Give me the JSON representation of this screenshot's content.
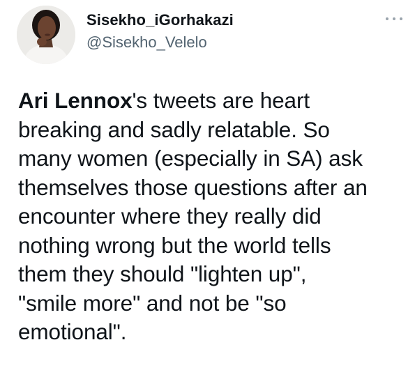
{
  "author": {
    "display_name": "Sisekho_iGorhakazi",
    "handle": "@Sisekho_Velelo"
  },
  "tweet": {
    "mention": "Ari Lennox",
    "lines": [
      "'s tweets are heart",
      "breaking and sadly relatable. So",
      "many women (especially in SA) ask",
      "themselves those questions after an",
      "encounter where they really did",
      "nothing wrong but the world tells",
      "them they should \"lighten up\",",
      "\"smile more\" and not be \"so",
      "emotional\"."
    ]
  },
  "icons": {
    "more": "more-horizontal-icon",
    "avatar": "user-avatar"
  }
}
